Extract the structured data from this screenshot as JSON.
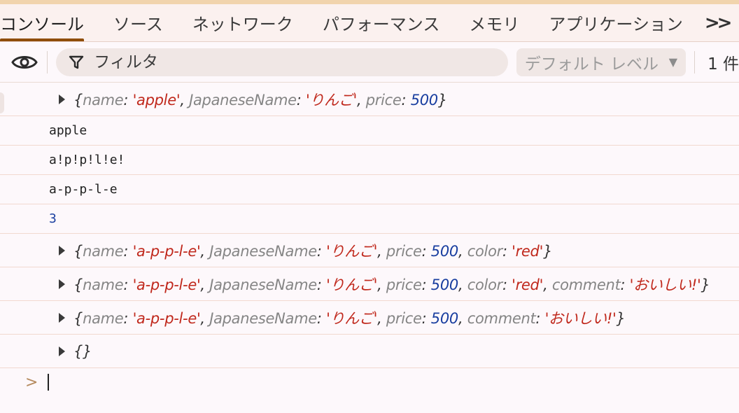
{
  "tabs": [
    "コンソール",
    "ソース",
    "ネットワーク",
    "パフォーマンス",
    "メモリ",
    "アプリケーション"
  ],
  "tab_more_label": ">>",
  "toolbar": {
    "filter_placeholder": "フィルタ",
    "levels_label": "デフォルト レベル",
    "count_label": "1 件"
  },
  "log": {
    "obj1": {
      "name": "'apple'",
      "jname": "'りんご'",
      "price": "500"
    },
    "text1": "apple",
    "text2": "a!p!p!l!e!",
    "text3": "a-p-p-l-e",
    "num1": "3",
    "obj2": {
      "name": "'a-p-p-l-e'",
      "jname": "'りんご'",
      "price": "500",
      "color": "'red'"
    },
    "obj3": {
      "name": "'a-p-p-l-e'",
      "jname": "'りんご'",
      "price": "500",
      "color": "'red'",
      "comment": "'おいしい!'"
    },
    "obj4": {
      "name": "'a-p-p-l-e'",
      "jname": "'りんご'",
      "price": "500",
      "comment": "'おいしい!'"
    },
    "obj5": "{}"
  },
  "keys": {
    "name": "name",
    "jname": "JapaneseName",
    "price": "price",
    "color": "color",
    "comment": "comment"
  },
  "prompt_symbol": ">"
}
